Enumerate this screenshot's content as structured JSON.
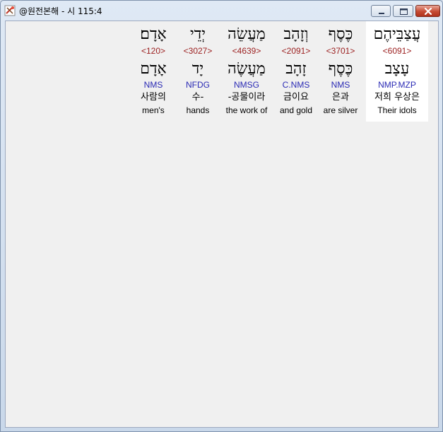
{
  "window": {
    "title": "@원전본해 - 시 115:4"
  },
  "words": [
    {
      "hebrew": "עֲצַבֵּיהֶם",
      "strong": "<6091>",
      "lemma": "עָצָב",
      "morph": "NMP.MZP",
      "korean": "저희 우상은",
      "english": "Their idols"
    },
    {
      "hebrew": "כֶּסֶף",
      "strong": "<3701>",
      "lemma": "כֶּסֶף",
      "morph": "NMS",
      "korean": "은과",
      "english": "are silver"
    },
    {
      "hebrew": "וְזָהָב",
      "strong": "<2091>",
      "lemma": "זָהָב",
      "morph": "C.NMS",
      "korean": "금이요",
      "english": "and gold"
    },
    {
      "hebrew": "מַעֲשֵׂה",
      "strong": "<4639>",
      "lemma": "מַעֲשֶׂה",
      "morph": "NMSG",
      "korean": "-공물이라",
      "english": "the work of"
    },
    {
      "hebrew": "יְדֵי",
      "strong": "<3027>",
      "lemma": "יָד",
      "morph": "NFDG",
      "korean": "수-",
      "english": "hands"
    },
    {
      "hebrew": "אָדָם׃",
      "strong": "<120>",
      "lemma": "אָדָם",
      "morph": "NMS",
      "korean": "사람의",
      "english": "men's"
    }
  ]
}
